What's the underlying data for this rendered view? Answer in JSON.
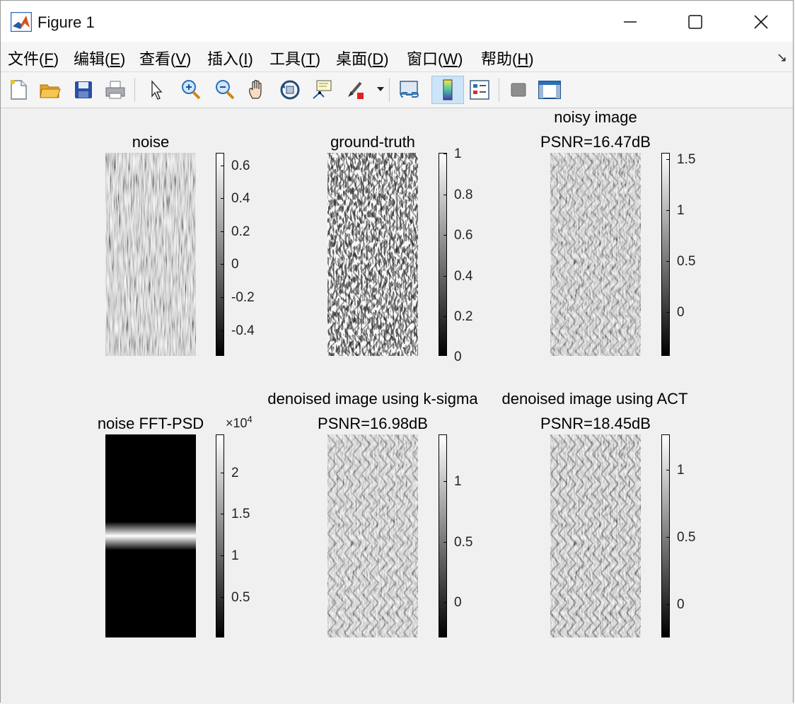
{
  "window": {
    "title": "Figure 1",
    "icon": "matlab-logo-icon",
    "controls": [
      "minimize-icon",
      "maximize-icon",
      "close-icon"
    ]
  },
  "menu": {
    "file": "文件(F)",
    "file_pre": "文件(",
    "file_key": "F",
    "file_post": ")",
    "edit_pre": "编辑(",
    "edit_key": "E",
    "edit_post": ")",
    "view_pre": "查看(",
    "view_key": "V",
    "view_post": ")",
    "insert_pre": "插入(",
    "insert_key": "I",
    "insert_post": ")",
    "tools_pre": "工具(",
    "tools_key": "T",
    "tools_post": ")",
    "desktop_pre": "桌面(",
    "desktop_key": "D",
    "desktop_post": ")",
    "window_pre": "窗口(",
    "window_key": "W",
    "window_post": ")",
    "help_pre": "帮助(",
    "help_key": "H",
    "help_post": ")",
    "dock_icon": "dock-arrow-icon",
    "dock_glyph": "↘"
  },
  "toolbar": {
    "icons": [
      "new-figure-icon",
      "open-file-icon",
      "save-icon",
      "print-icon",
      "select-arrow-icon",
      "zoom-in-icon",
      "zoom-out-icon",
      "pan-hand-icon",
      "rotate-3d-icon",
      "data-cursor-icon",
      "brush-icon",
      "brush-dropdown-icon",
      "link-plot-icon",
      "colorbar-icon",
      "legend-icon",
      "hide-plot-tools-icon",
      "show-plot-tools-icon"
    ],
    "active": "colorbar-icon"
  },
  "plots": [
    {
      "title1": "noise",
      "title2": "",
      "ticks": [
        "0.6",
        "0.4",
        "0.2",
        "0",
        "-0.2",
        "-0.4"
      ],
      "exponent": ""
    },
    {
      "title1": "ground-truth",
      "title2": "",
      "ticks": [
        "1",
        "0.8",
        "0.6",
        "0.4",
        "0.2",
        "0"
      ],
      "exponent": ""
    },
    {
      "title1": "noisy image",
      "title2": "PSNR=16.47dB",
      "ticks": [
        "1.5",
        "1",
        "0.5",
        "0"
      ],
      "exponent": ""
    },
    {
      "title1": "noise FFT-PSD",
      "title2": "",
      "ticks": [
        "2",
        "1.5",
        "1",
        "0.5"
      ],
      "exponent_base": "×10",
      "exponent_power": "4"
    },
    {
      "title1": "denoised image using k-sigma",
      "title2": "PSNR=16.98dB",
      "ticks": [
        "1",
        "0.5",
        "0"
      ],
      "exponent": ""
    },
    {
      "title1": "denoised image using ACT",
      "title2": "PSNR=18.45dB",
      "ticks": [
        "1",
        "0.5",
        "0"
      ],
      "exponent": ""
    }
  ]
}
